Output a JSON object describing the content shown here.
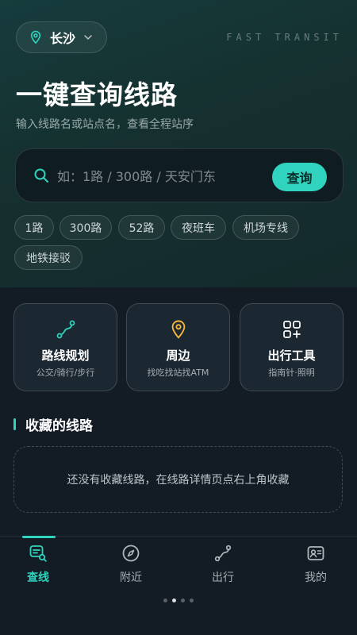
{
  "header": {
    "city": "长沙",
    "brand": "FAST TRANSIT",
    "title": "一键查询线路",
    "subtitle": "输入线路名或站点名，查看全程站序"
  },
  "search": {
    "placeholder": "如：1路 / 300路 / 天安门东",
    "button_label": "查询"
  },
  "quick_chips": [
    "1路",
    "300路",
    "52路",
    "夜班车",
    "机场专线",
    "地铁接驳"
  ],
  "feature_cards": [
    {
      "title": "路线规划",
      "subtitle": "公交/骑行/步行",
      "icon": "route-icon"
    },
    {
      "title": "周边",
      "subtitle": "找吃找站找ATM",
      "icon": "location-pin-icon"
    },
    {
      "title": "出行工具",
      "subtitle": "指南针·照明",
      "icon": "tools-grid-icon"
    }
  ],
  "favorites": {
    "title": "收藏的线路",
    "empty_text": "还没有收藏线路，在线路详情页点右上角收藏"
  },
  "tabbar": {
    "tabs": [
      {
        "label": "查线",
        "icon": "bus-search-icon",
        "active": true
      },
      {
        "label": "附近",
        "icon": "compass-icon",
        "active": false
      },
      {
        "label": "出行",
        "icon": "route-icon",
        "active": false
      },
      {
        "label": "我的",
        "icon": "profile-card-icon",
        "active": false
      }
    ],
    "page_count": 4,
    "current_page": 2
  },
  "colors": {
    "accent": "#2fd3be",
    "hero_bg": "#163c3d",
    "page_bg": "#131c25",
    "card_bg": "#1b2731",
    "nearby_pin": "#f5b53c"
  }
}
